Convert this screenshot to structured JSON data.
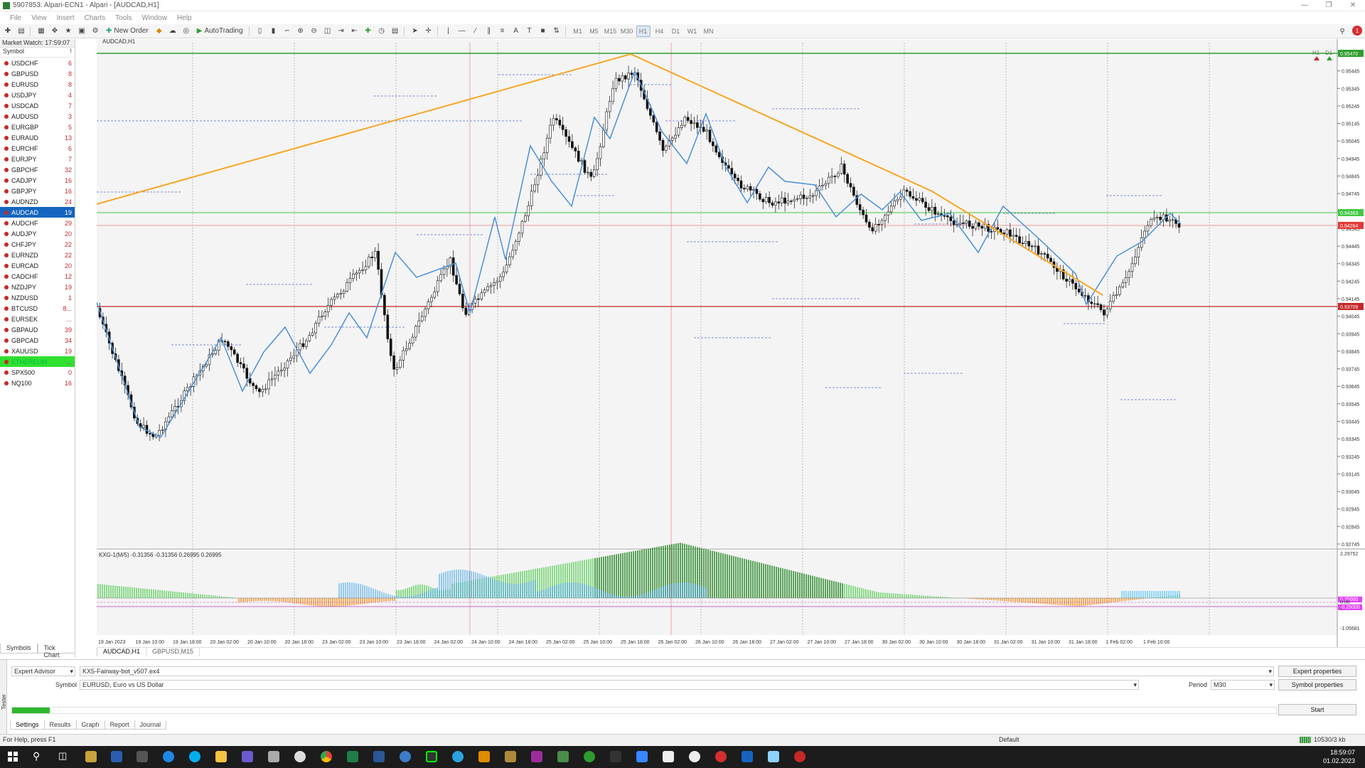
{
  "titlebar": {
    "title": "5907853: Alpari-ECN1 - Alpari - [AUDCAD,H1]"
  },
  "menu": [
    "File",
    "View",
    "Insert",
    "Charts",
    "Tools",
    "Window",
    "Help"
  ],
  "toolbar": {
    "new_order": "New Order",
    "auto_trading": "AutoTrading",
    "timeframes": [
      "M1",
      "M5",
      "M15",
      "M30",
      "H1",
      "H4",
      "D1",
      "W1",
      "MN"
    ]
  },
  "market_watch": {
    "title": "Market Watch: 17:59:07",
    "col_symbol": "Symbol",
    "col_spread": "!",
    "items": [
      {
        "symbol": "USDCHF",
        "spread": "6"
      },
      {
        "symbol": "GBPUSD",
        "spread": "8"
      },
      {
        "symbol": "EURUSD",
        "spread": "8"
      },
      {
        "symbol": "USDJPY",
        "spread": "4"
      },
      {
        "symbol": "USDCAD",
        "spread": "7"
      },
      {
        "symbol": "AUDUSD",
        "spread": "3"
      },
      {
        "symbol": "EURGBP",
        "spread": "5"
      },
      {
        "symbol": "EURAUD",
        "spread": "13"
      },
      {
        "symbol": "EURCHF",
        "spread": "6"
      },
      {
        "symbol": "EURJPY",
        "spread": "7"
      },
      {
        "symbol": "GBPCHF",
        "spread": "32"
      },
      {
        "symbol": "CADJPY",
        "spread": "16"
      },
      {
        "symbol": "GBPJPY",
        "spread": "16"
      },
      {
        "symbol": "AUDNZD",
        "spread": "24"
      },
      {
        "symbol": "AUDCAD",
        "spread": "19"
      },
      {
        "symbol": "AUDCHF",
        "spread": "29"
      },
      {
        "symbol": "AUDJPY",
        "spread": "20"
      },
      {
        "symbol": "CHFJPY",
        "spread": "22"
      },
      {
        "symbol": "EURNZD",
        "spread": "22"
      },
      {
        "symbol": "EURCAD",
        "spread": "20"
      },
      {
        "symbol": "CADCHF",
        "spread": "12"
      },
      {
        "symbol": "NZDJPY",
        "spread": "19"
      },
      {
        "symbol": "NZDUSD",
        "spread": "1"
      },
      {
        "symbol": "BTCUSD",
        "spread": "8..."
      },
      {
        "symbol": "EURSEK",
        "spread": "..."
      },
      {
        "symbol": "GBPAUD",
        "spread": "39"
      },
      {
        "symbol": "GBPCAD",
        "spread": "34"
      },
      {
        "symbol": "XAUUSD",
        "spread": "19"
      },
      {
        "symbol": "ETHEREUM",
        "spread": "..."
      },
      {
        "symbol": "SPX500",
        "spread": "0"
      },
      {
        "symbol": "NQ100",
        "spread": "16"
      }
    ],
    "selected_symbol": "AUDCAD",
    "highlighted_symbol": "ETHEREUM",
    "tabs": [
      "Symbols",
      "Tick Chart"
    ]
  },
  "chart": {
    "label": "AUDCAD,H1",
    "indicator_label": "KXG-1(M/5) -0.31356 -0.31356 0.26995 0.26995",
    "top_right_tfs": [
      "H1",
      "D1"
    ],
    "price_labels": [
      "0.95545",
      "0.95445",
      "0.95345",
      "0.95245",
      "0.95145",
      "0.95045",
      "0.94945",
      "0.94845",
      "0.94745",
      "0.94645",
      "0.94545",
      "0.94445",
      "0.94345",
      "0.94245",
      "0.94145",
      "0.94045",
      "0.93945",
      "0.93845",
      "0.93745",
      "0.93645",
      "0.93545",
      "0.93445",
      "0.93345",
      "0.93245",
      "0.93145",
      "0.93045",
      "0.92945",
      "0.92845",
      "0.92745"
    ],
    "marker_top": "0.95470",
    "marker_green": "0.94363",
    "marker_bid": "0.94264",
    "marker_red": "0.93709",
    "ind_labels": [
      "2.29752",
      "0.25000",
      "0.00",
      "-0.25000",
      "-1.05681"
    ],
    "time_labels": [
      "19 Jan 2023",
      "19 Jan 10:00",
      "19 Jan 18:00",
      "20 Jan 02:00",
      "20 Jan 10:00",
      "20 Jan 18:00",
      "23 Jan 02:00",
      "23 Jan 10:00",
      "23 Jan 18:00",
      "24 Jan 02:00",
      "24 Jan 10:00",
      "24 Jan 18:00",
      "25 Jan 02:00",
      "25 Jan 10:00",
      "25 Jan 18:00",
      "26 Jan 02:00",
      "26 Jan 10:00",
      "26 Jan 18:00",
      "27 Jan 02:00",
      "27 Jan 10:00",
      "27 Jan 18:00",
      "30 Jan 02:00",
      "30 Jan 10:00",
      "30 Jan 18:00",
      "31 Jan 02:00",
      "31 Jan 10:00",
      "31 Jan 18:00",
      "1 Feb 02:00",
      "1 Feb 10:00"
    ],
    "tabs": [
      "AUDCAD,H1",
      "GBPUSD,M15"
    ],
    "colors": {
      "trend": "#f5a623",
      "zigzag": "#4a90d9",
      "green_level": "#2e9e2e",
      "red_level": "#c62828"
    }
  },
  "tester": {
    "mode": "Expert Advisor",
    "expert_file": "KX5-Fairway-bot_v507.ex4",
    "symbol_label": "Symbol",
    "symbol_value": "EURUSD, Euro vs US Dollar",
    "period_label": "Period",
    "period_value": "M30",
    "btn_expert_props": "Expert properties",
    "btn_symbol_props": "Symbol properties",
    "btn_start": "Start",
    "progress": 0.03,
    "tabs": [
      "Settings",
      "Results",
      "Graph",
      "Report",
      "Journal"
    ],
    "side_label": "Tester"
  },
  "statusbar": {
    "help": "For Help, press F1",
    "profile": "Default",
    "traffic": "10530/3 kb"
  },
  "taskbar": {
    "time": "18:59:07",
    "date": "01.02.2023"
  }
}
